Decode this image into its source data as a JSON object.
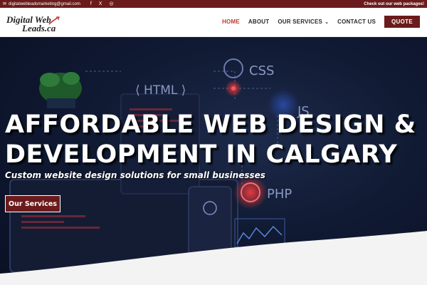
{
  "topbar": {
    "email": "digitalwebleadsmarketing@gmail.com",
    "socials": [
      {
        "icon": "facebook-icon",
        "glyph": "f"
      },
      {
        "icon": "x-icon",
        "glyph": "X"
      },
      {
        "icon": "instagram-icon",
        "glyph": "◎"
      }
    ],
    "promo": "Check out our web packages!"
  },
  "logo": {
    "line1": "Digital Web",
    "line2": "Leads.ca"
  },
  "nav": {
    "home": "HOME",
    "about": "ABOUT",
    "services": "OUR SERVICES",
    "contact": "CONTACT US",
    "quote": "QUOTE"
  },
  "hero": {
    "title_line1": "AFFORDABLE WEB DESIGN &",
    "title_line2": "DEVELOPMENT IN CALGARY",
    "subtitle": "Custom website design solutions for small businesses",
    "cta": "Our Services",
    "bg_labels": {
      "html": "HTML",
      "css": "CSS",
      "js": "JS",
      "php": "PHP"
    }
  },
  "colors": {
    "brand": "#6b1b1b",
    "active_nav": "#c0392b",
    "hero_bg": "#101a33"
  }
}
